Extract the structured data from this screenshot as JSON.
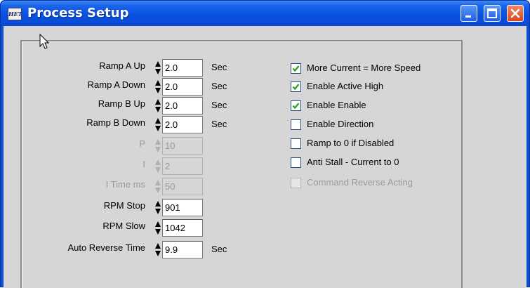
{
  "window": {
    "title": "Process Setup",
    "icon_text": "HET",
    "icons": [
      "minimize-icon",
      "maximize-icon",
      "close-icon"
    ],
    "title_color": "#0a4fd8"
  },
  "fields": [
    {
      "label": "Ramp A Up",
      "value": "2.0",
      "unit": "Sec",
      "enabled": true
    },
    {
      "label": "Ramp A Down",
      "value": "2.0",
      "unit": "Sec",
      "enabled": true
    },
    {
      "label": "Ramp B Up",
      "value": "2.0",
      "unit": "Sec",
      "enabled": true
    },
    {
      "label": "Ramp B Down",
      "value": "2.0",
      "unit": "Sec",
      "enabled": true
    },
    {
      "label": "P",
      "value": "10",
      "unit": "",
      "enabled": false
    },
    {
      "label": "I",
      "value": "2",
      "unit": "",
      "enabled": false
    },
    {
      "label": "I Time ms",
      "value": "50",
      "unit": "",
      "enabled": false
    },
    {
      "label": "RPM Stop",
      "value": "901",
      "unit": "",
      "enabled": true
    },
    {
      "label": "RPM Slow",
      "value": "1042",
      "unit": "",
      "enabled": true
    },
    {
      "label": "Auto Reverse Time",
      "value": "9.9",
      "unit": "Sec",
      "enabled": true
    }
  ],
  "checkboxes": [
    {
      "label": "More Current = More Speed",
      "checked": true,
      "enabled": true
    },
    {
      "label": "Enable Active High",
      "checked": true,
      "enabled": true
    },
    {
      "label": "Enable Enable",
      "checked": true,
      "enabled": true
    },
    {
      "label": "Enable Direction",
      "checked": false,
      "enabled": true
    },
    {
      "label": "Ramp to 0 if Disabled",
      "checked": false,
      "enabled": true
    },
    {
      "label": "Anti Stall - Current to 0",
      "checked": false,
      "enabled": true
    },
    {
      "label": "Command Reverse Acting",
      "checked": false,
      "enabled": false
    }
  ],
  "colors": {
    "check": "#21a121",
    "disabled_text": "#9a9a9a",
    "client_bg": "#d6d6d6"
  }
}
